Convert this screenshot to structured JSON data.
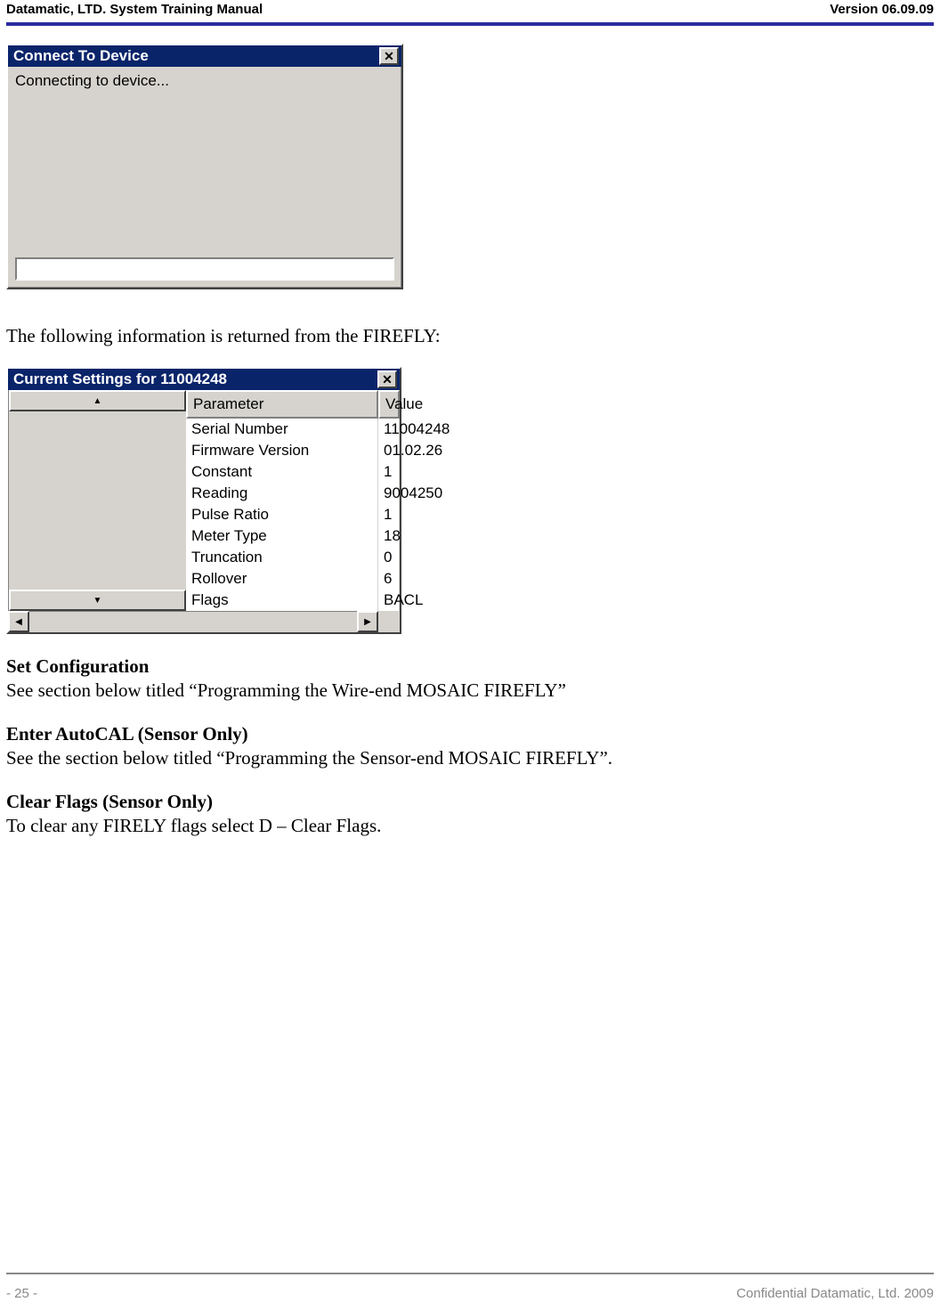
{
  "header": {
    "left": "Datamatic, LTD. System Training  Manual",
    "right": "Version 06.09.09"
  },
  "dialog_connect": {
    "title": "Connect To Device",
    "message": "Connecting to device..."
  },
  "body": {
    "intro_para": "The following information is returned from the FIREFLY:"
  },
  "dialog_settings": {
    "title": "Current Settings for 11004248",
    "columns": {
      "param": "Parameter",
      "value": "Value"
    },
    "rows": [
      {
        "param": "Serial Number",
        "value": "11004248"
      },
      {
        "param": "Firmware Version",
        "value": "01.02.26"
      },
      {
        "param": "Constant",
        "value": "1"
      },
      {
        "param": "Reading",
        "value": "9004250"
      },
      {
        "param": "Pulse Ratio",
        "value": "1"
      },
      {
        "param": "Meter Type",
        "value": "18"
      },
      {
        "param": "Truncation",
        "value": "0"
      },
      {
        "param": "Rollover",
        "value": "6"
      },
      {
        "param": "Flags",
        "value": "BACL"
      }
    ]
  },
  "sections": {
    "set_config": {
      "title": "Set Configuration",
      "body": "See section below titled “Programming the Wire-end MOSAIC FIREFLY”"
    },
    "enter_autocal": {
      "title": "Enter AutoCAL (Sensor Only)",
      "body": "See the section below titled “Programming the Sensor-end MOSAIC FIREFLY”."
    },
    "clear_flags": {
      "title": "Clear Flags (Sensor Only)",
      "body": "To clear any FIRELY flags select D – Clear Flags."
    }
  },
  "footer": {
    "page": "- 25 -",
    "copyright": "Confidential Datamatic, Ltd. 2009"
  },
  "icons": {
    "up": "▲",
    "down": "▼",
    "left": "◀",
    "right": "▶",
    "close": "✕"
  }
}
